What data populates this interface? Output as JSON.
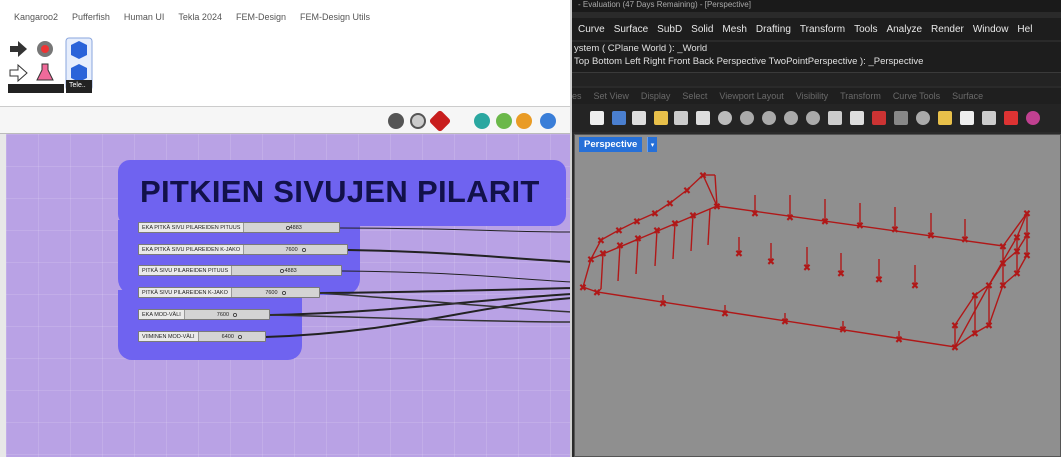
{
  "grasshopper": {
    "ribbon_tabs": [
      "Kangaroo2",
      "Pufferfish",
      "Human UI",
      "Tekla 2024",
      "FEM-Design",
      "FEM-Design Utils"
    ],
    "ribbon_group_label": "Tele..",
    "group_title": "PITKIEN SIVUJEN PILARIT",
    "sliders": [
      {
        "label": "EKA PITKÄ SIVU PILAREIDEN PITUUS",
        "value": "4883"
      },
      {
        "label": "EKA PITKÄ SIVU PILAREIDEN K-JAKO",
        "value": "7600"
      },
      {
        "label": "PITKÄ SIVU PILAREIDEN PITUUS",
        "value": "4883"
      },
      {
        "label": "PITKÄ SIVU PILAREIDEN K-JAKO",
        "value": "7600"
      },
      {
        "label": "EKA MOD-VÄLI",
        "value": "7600"
      },
      {
        "label": "VIIMINEN MOD-VÄLI",
        "value": "6400"
      }
    ],
    "canvas_color": "#b9a2e5",
    "group_color": "#6f63f0"
  },
  "rhino": {
    "title": "- Evaluation (47 Days Remaining) - [Perspective]",
    "menu": [
      "Curve",
      "Surface",
      "SubD",
      "Solid",
      "Mesh",
      "Drafting",
      "Transform",
      "Tools",
      "Analyze",
      "Render",
      "Window",
      "Hel"
    ],
    "command_line_1": "ystem ( CPlane World ): _World",
    "command_line_2": "Top Bottom Left Right Front Back Perspective TwoPointPerspective ): _Perspective",
    "toolbar_tabs": [
      "es",
      "Set View",
      "Display",
      "Select",
      "Viewport Layout",
      "Visibility",
      "Transform",
      "Curve Tools",
      "Surface"
    ],
    "viewport_label": "Perspective",
    "viewport_bg": "#8f8f8f",
    "geometry_color": "#b01818"
  }
}
